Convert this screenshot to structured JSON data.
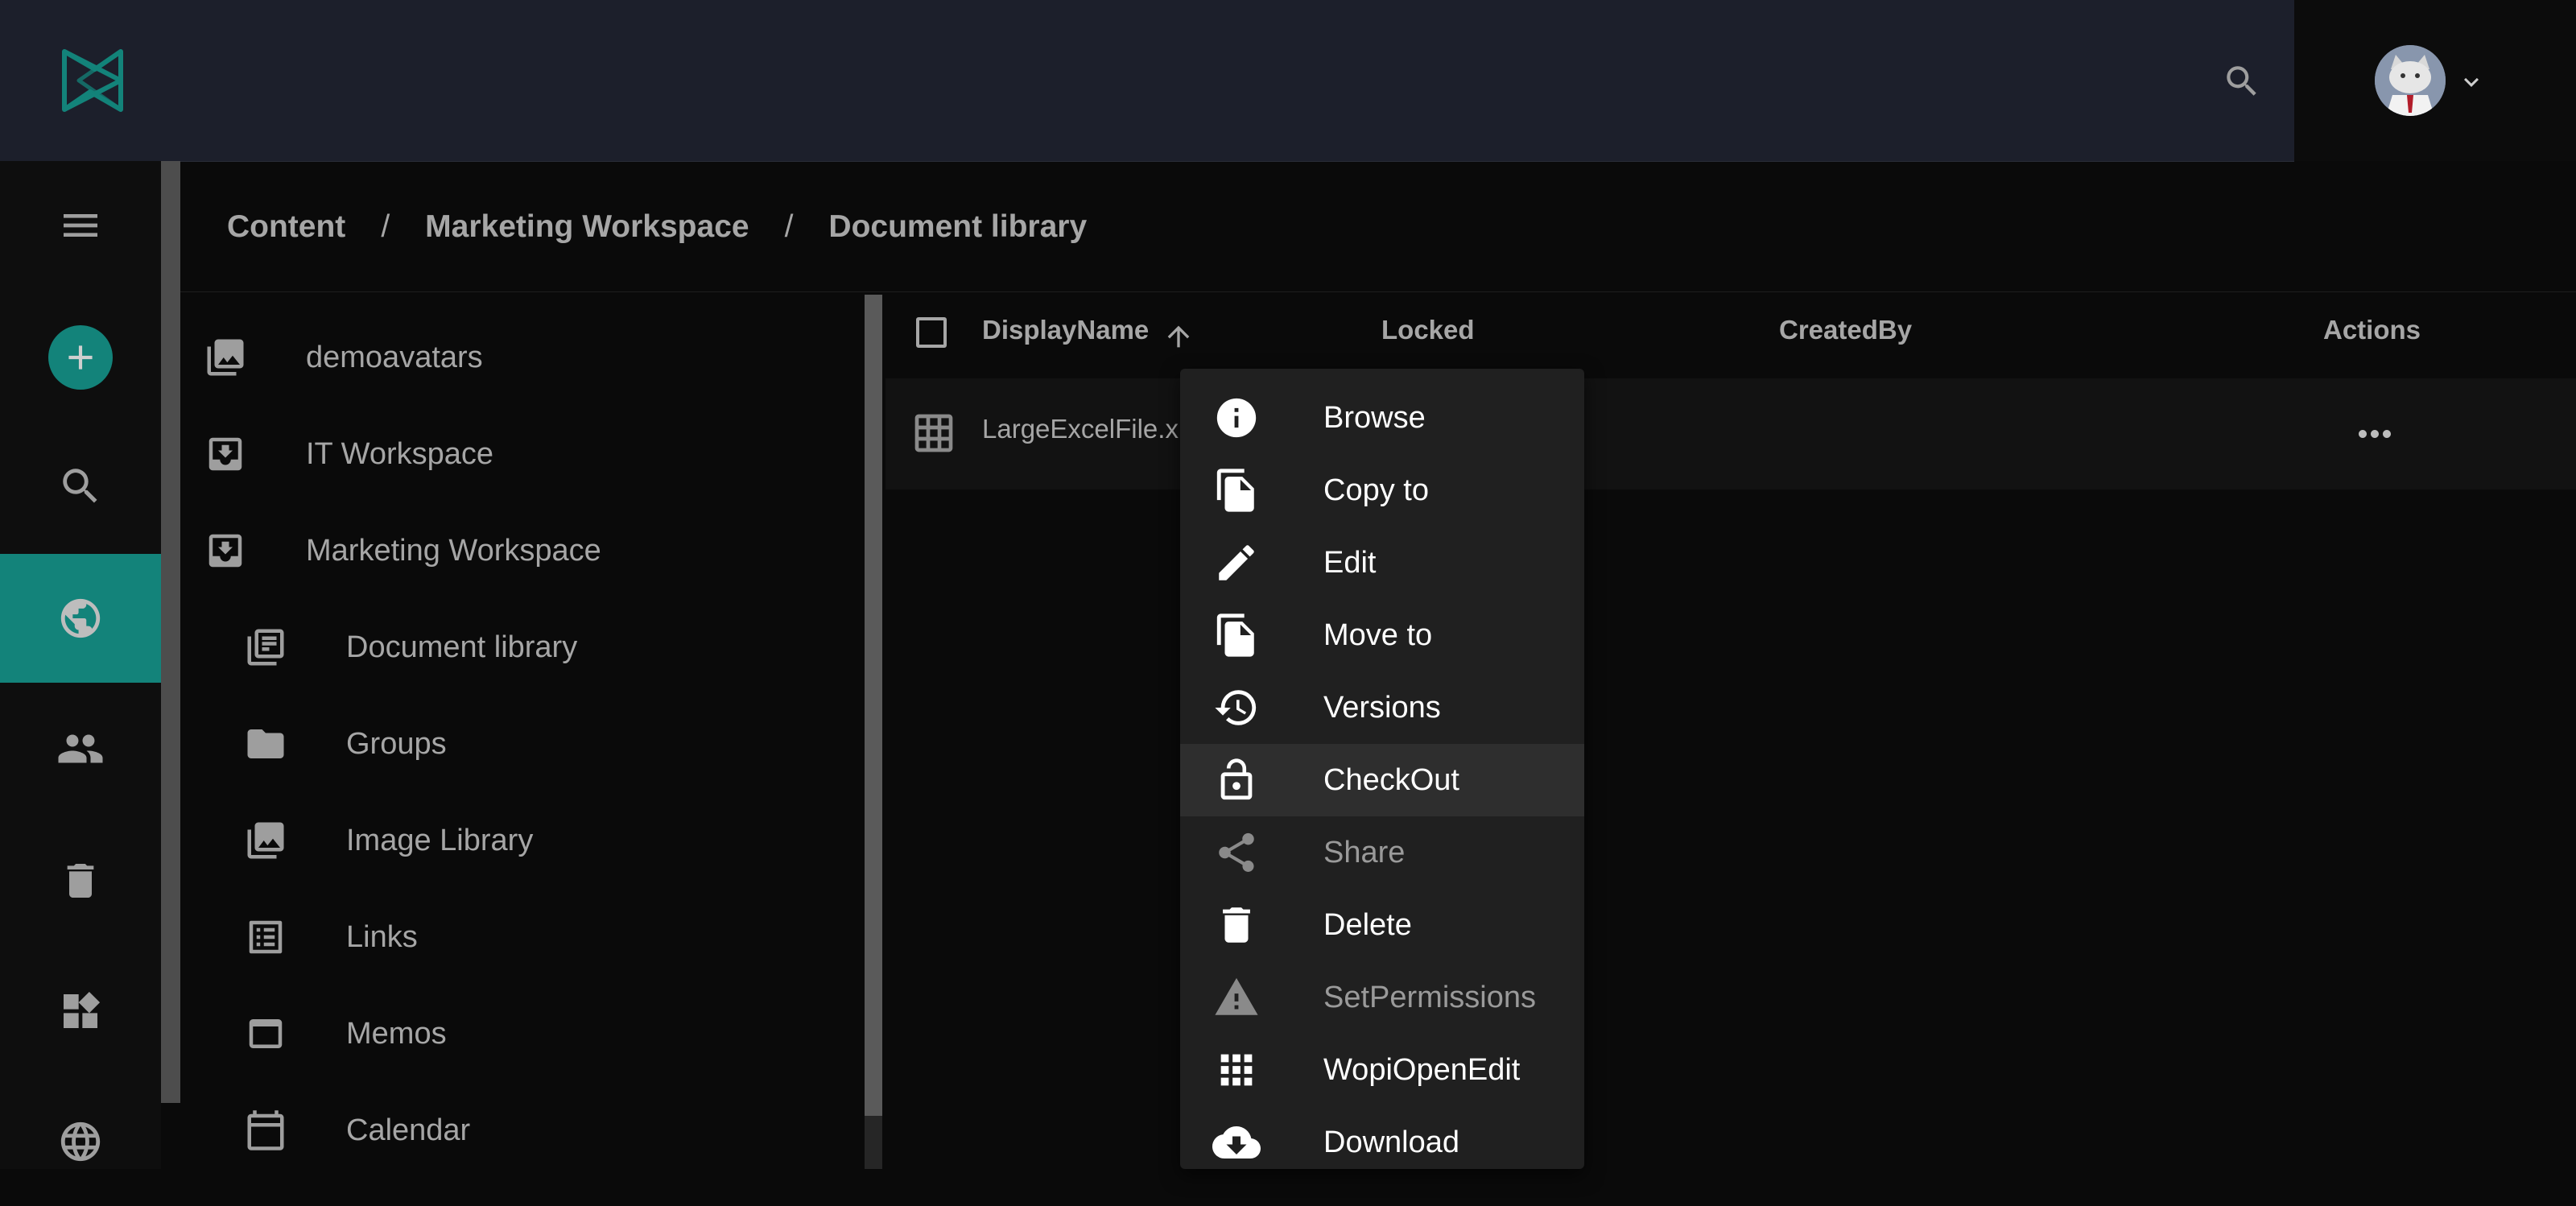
{
  "colors": {
    "accent": "#13837a",
    "topbar": "#1c1f2b",
    "background": "#0a0a0a"
  },
  "topbar": {
    "logo_icon": "app-logo",
    "search_icon": "search-icon",
    "user_menu_icon": "chevron-down-icon"
  },
  "rail": {
    "items": [
      {
        "icon": "menu-icon"
      },
      {
        "icon": "add-icon"
      },
      {
        "icon": "search-icon"
      },
      {
        "icon": "globe-icon",
        "active": true
      },
      {
        "icon": "users-icon"
      },
      {
        "icon": "trash-icon"
      },
      {
        "icon": "dashboard-icon"
      },
      {
        "icon": "language-icon"
      }
    ]
  },
  "breadcrumb": [
    "Content",
    "Marketing Workspace",
    "Document library"
  ],
  "breadcrumb_separator": "/",
  "tree": [
    {
      "label": "demoavatars",
      "icon": "image-library-icon"
    },
    {
      "label": "IT Workspace",
      "icon": "workspace-icon"
    },
    {
      "label": "Marketing Workspace",
      "icon": "workspace-icon"
    },
    {
      "label": "Document library",
      "icon": "document-library-icon"
    },
    {
      "label": "Groups",
      "icon": "folder-icon"
    },
    {
      "label": "Image Library",
      "icon": "image-library-icon"
    },
    {
      "label": "Links",
      "icon": "list-icon"
    },
    {
      "label": "Memos",
      "icon": "memo-icon"
    },
    {
      "label": "Calendar",
      "icon": "calendar-icon"
    }
  ],
  "grid": {
    "columns": [
      "DisplayName",
      "Locked",
      "CreatedBy",
      "Actions"
    ],
    "sort_column": "DisplayName",
    "rows": [
      {
        "name": "LargeExcelFile.xlsx",
        "icon": "spreadsheet-icon"
      }
    ]
  },
  "context_menu": [
    {
      "label": "Browse",
      "icon": "info-icon",
      "enabled": true
    },
    {
      "label": "Copy to",
      "icon": "copy-icon",
      "enabled": true
    },
    {
      "label": "Edit",
      "icon": "edit-icon",
      "enabled": true
    },
    {
      "label": "Move to",
      "icon": "move-icon",
      "enabled": true
    },
    {
      "label": "Versions",
      "icon": "history-icon",
      "enabled": true
    },
    {
      "label": "CheckOut",
      "icon": "lock-open-icon",
      "enabled": true,
      "highlighted": true
    },
    {
      "label": "Share",
      "icon": "share-icon",
      "enabled": false
    },
    {
      "label": "Delete",
      "icon": "delete-icon",
      "enabled": true
    },
    {
      "label": "SetPermissions",
      "icon": "warning-icon",
      "enabled": false
    },
    {
      "label": "WopiOpenEdit",
      "icon": "apps-grid-icon",
      "enabled": true
    },
    {
      "label": "Download",
      "icon": "cloud-download-icon",
      "enabled": true
    }
  ]
}
